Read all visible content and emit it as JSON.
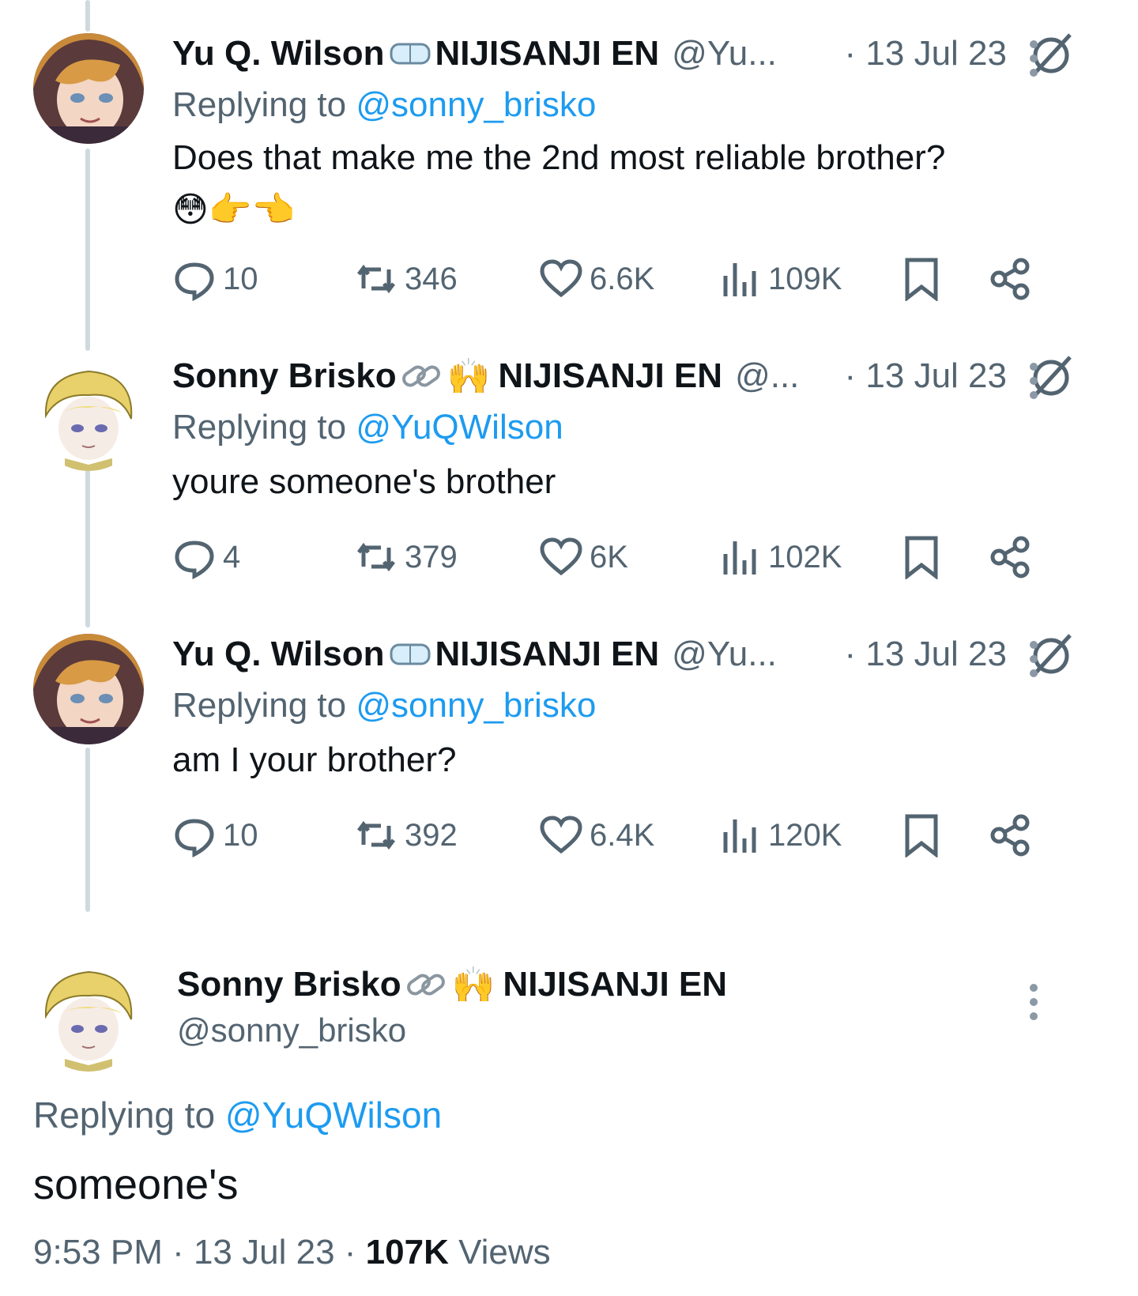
{
  "colors": {
    "link": "#1d9bf0",
    "secondary": "#536471",
    "primary": "#0f1419",
    "thread_line": "#cfd9de"
  },
  "tweets": [
    {
      "name": "Yu Q. Wilson",
      "badge_icon": "goggles-icon",
      "org": "NIJISANJI EN",
      "handle": "@Yu...",
      "date": "· 13 Jul 23",
      "replying_prefix": "Replying to",
      "replying_to": "@sonny_brisko",
      "text_line1": "Does that make me the 2nd most reliable brother?",
      "text_line2": "😳👉👈",
      "replies": "10",
      "reposts": "346",
      "likes": "6.6K",
      "views": "109K"
    },
    {
      "name": "Sonny Brisko",
      "badge_icon": "link-icon",
      "badge_emoji": "🙌",
      "org": "NIJISANJI EN",
      "handle": "@...",
      "date": "· 13 Jul 23",
      "replying_prefix": "Replying to",
      "replying_to": "@YuQWilson",
      "text_line1": "youre someone's brother",
      "replies": "4",
      "reposts": "379",
      "likes": "6K",
      "views": "102K"
    },
    {
      "name": "Yu Q. Wilson",
      "badge_icon": "goggles-icon",
      "org": "NIJISANJI EN",
      "handle": "@Yu...",
      "date": "· 13 Jul 23",
      "replying_prefix": "Replying to",
      "replying_to": "@sonny_brisko",
      "text_line1": "am I your brother?",
      "replies": "10",
      "reposts": "392",
      "likes": "6.4K",
      "views": "120K"
    }
  ],
  "main": {
    "name": "Sonny Brisko",
    "badge_emoji": "🙌",
    "org": "NIJISANJI EN",
    "handle": "@sonny_brisko",
    "replying_prefix": "Replying to",
    "replying_to": "@YuQWilson",
    "text": "someone's",
    "time": "9:53 PM · 13 Jul 23 · ",
    "views_count": "107K",
    "views_label": " Views"
  }
}
